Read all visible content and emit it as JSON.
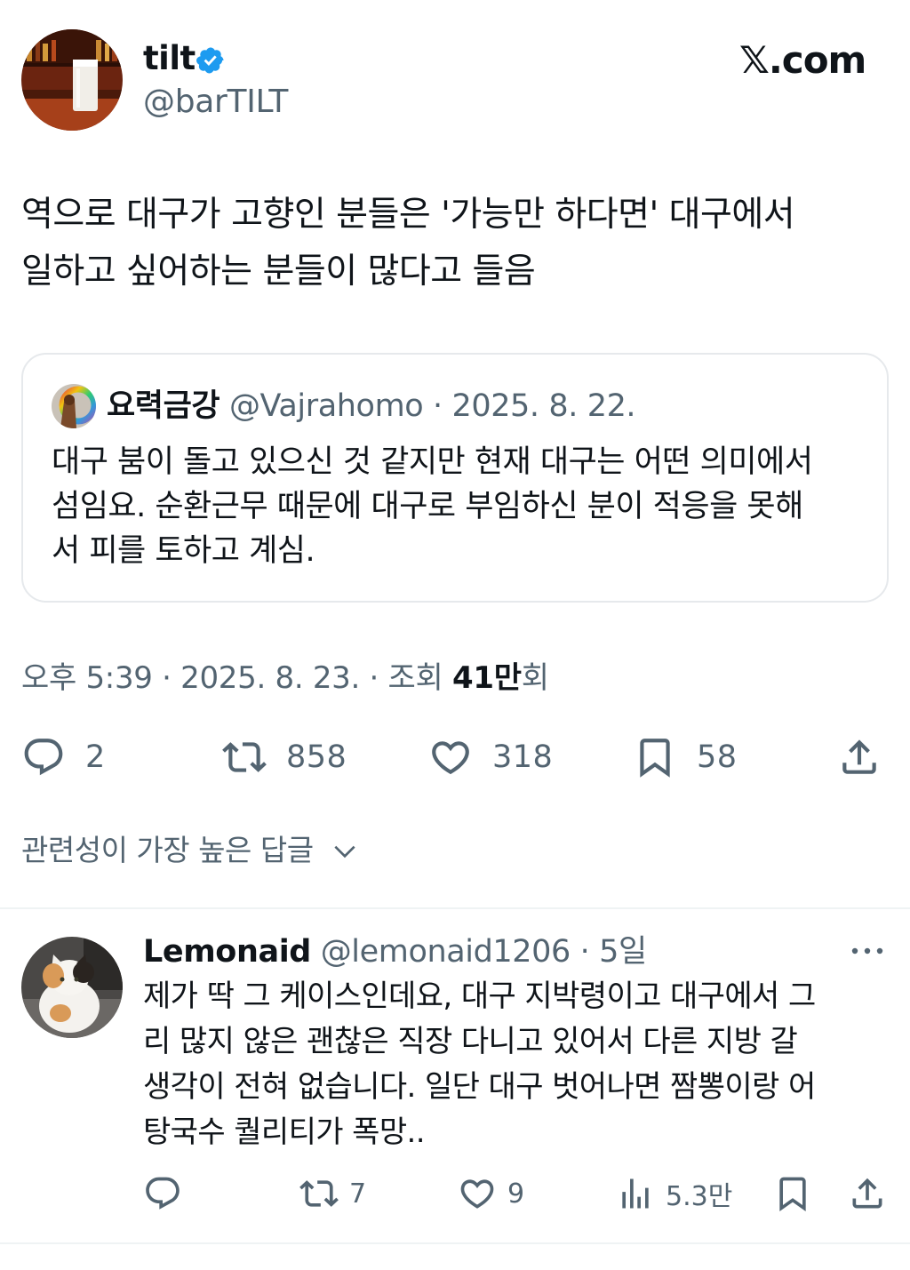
{
  "author": {
    "name": "tilt",
    "handle": "@barTILT"
  },
  "site_label": "𝕏.com",
  "tweet": {
    "lines": [
      "역으로 대구가 고향인 분들은 '가능만 하다면' 대구에서",
      "일하고 싶어하는 분들이 많다고 들음"
    ]
  },
  "quote": {
    "name": "요력금강",
    "meta": "@Vajrahomo · 2025. 8. 22.",
    "lines": [
      "대구 붐이 돌고 있으신 것 같지만 현재 대구는 어떤 의미에서",
      "섬임요. 순환근무 때문에 대구로 부임하신 분이 적응을 못해",
      "서 피를 토하고 계심."
    ]
  },
  "meta": {
    "time": "오후 5:39 · 2025. 8. 23. · 조회 ",
    "views_number": "41만",
    "views_suffix": "회"
  },
  "actions": {
    "replies": "2",
    "reposts": "858",
    "likes": "318",
    "bookmarks": "58"
  },
  "sort_label": "관련성이 가장 높은 답글",
  "reply": {
    "name": "Lemonaid",
    "meta": "@lemonaid1206 · 5일",
    "lines": [
      "제가 딱 그 케이스인데요, 대구 지박령이고 대구에서 그",
      "리 많지 않은 괜찮은 직장 다니고 있어서 다른 지방 갈",
      "생각이 전혀 없습니다. 일단 대구 벗어나면 짬뽕이랑 어",
      "탕국수 퀄리티가 폭망.."
    ],
    "reposts": "7",
    "likes": "9",
    "views": "5.3만"
  },
  "colors": {
    "text": "#0f1419",
    "secondary": "#536471",
    "verified": "#1d9bf0",
    "border": "#e6e9ec"
  },
  "icons": [
    "verified-badge-icon",
    "reply-icon",
    "repost-icon",
    "like-icon",
    "bookmark-icon",
    "share-icon",
    "chevron-down-icon",
    "more-icon",
    "views-icon"
  ]
}
